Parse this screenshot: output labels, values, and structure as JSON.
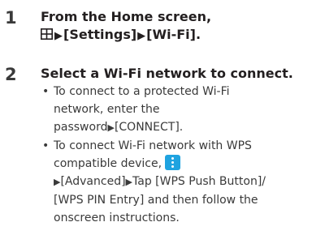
{
  "steps": [
    {
      "number": "1",
      "line1": "From the Home screen,",
      "line2_parts": [
        "[Settings]",
        "[Wi-Fi]."
      ],
      "icons": [
        "apps-grid-icon",
        "right-arrow-icon"
      ]
    },
    {
      "number": "2",
      "title": "Select a Wi-Fi network to connect.",
      "bullets": [
        {
          "l1": "To connect to a protected Wi-Fi",
          "l2": "network, enter the",
          "l3a": "password",
          "l3b": "[CONNECT]."
        },
        {
          "l1": "To connect Wi-Fi network with WPS",
          "l2": "compatible device,",
          "l3": "[Advanced]",
          "l3b": "Tap [WPS Push Button]/",
          "l4": "[WPS PIN Entry] and then follow the",
          "l5": "onscreen instructions."
        }
      ]
    }
  ],
  "colors": {
    "text": "#231f20",
    "menu_icon": "#1fa3e0"
  }
}
